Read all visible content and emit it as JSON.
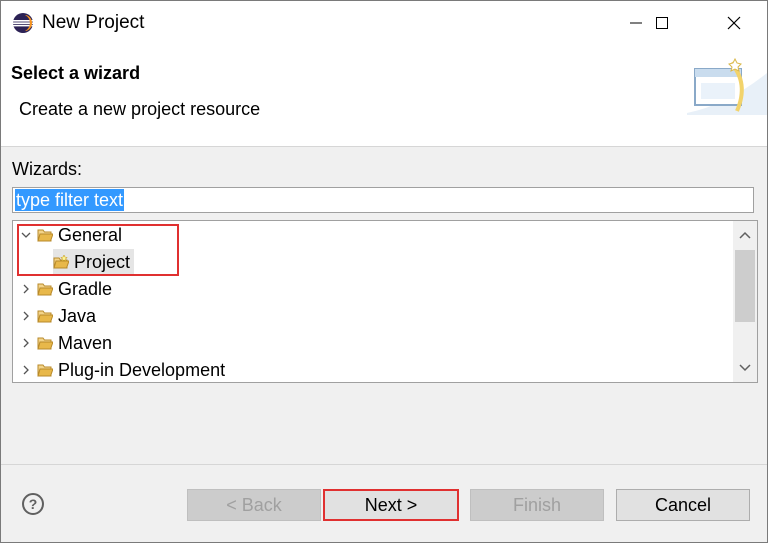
{
  "window": {
    "title": "New Project"
  },
  "banner": {
    "title": "Select a wizard",
    "description": "Create a new project resource"
  },
  "wizards": {
    "label": "Wizards:",
    "filter_text": "type filter text",
    "tree": [
      {
        "label": "General",
        "expanded": true
      },
      {
        "label": "Project",
        "selected": true
      },
      {
        "label": "Gradle",
        "expanded": false
      },
      {
        "label": "Java",
        "expanded": false
      },
      {
        "label": "Maven",
        "expanded": false
      },
      {
        "label": "Plug-in Development",
        "expanded": false
      }
    ]
  },
  "footer": {
    "help_symbol": "?",
    "back_label": "< Back",
    "next_label": "Next >",
    "finish_label": "Finish",
    "cancel_label": "Cancel"
  },
  "colors": {
    "highlight": "#e03030",
    "selection": "#3399ff",
    "folder": "#e8b84a"
  }
}
